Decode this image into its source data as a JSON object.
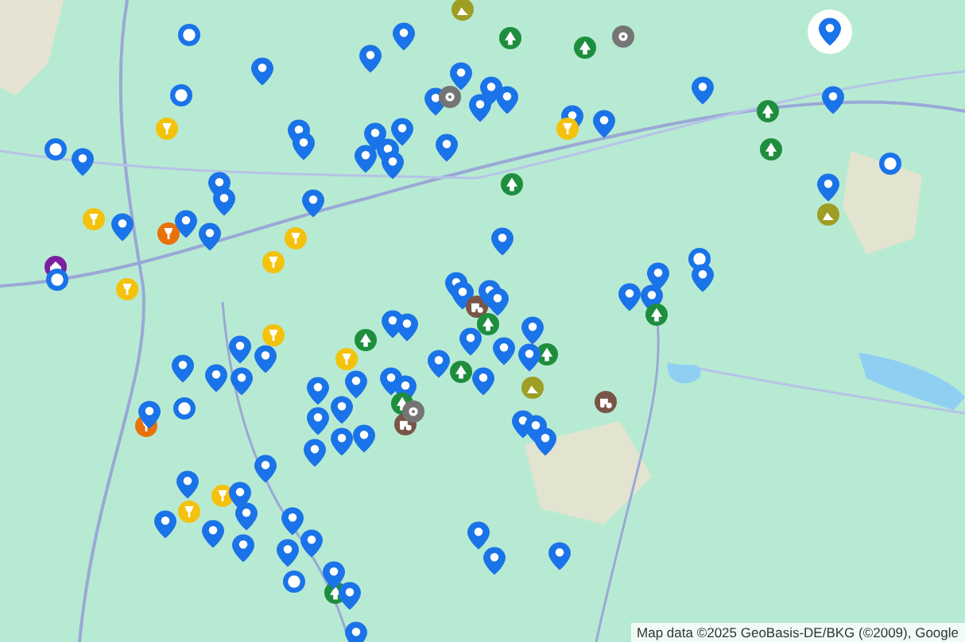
{
  "map": {
    "attribution": "Map data ©2025 GeoBasis-DE/BKG (©2009), Google"
  },
  "markers": [
    {
      "kind": "ring",
      "selected": false
    },
    {
      "kind": "ring",
      "selected": false
    },
    {
      "kind": "pin",
      "selected": false
    },
    {
      "kind": "cafe",
      "selected": false
    },
    {
      "kind": "ring",
      "selected": false
    },
    {
      "kind": "pin",
      "selected": false
    },
    {
      "kind": "pin",
      "selected": false
    },
    {
      "kind": "pin",
      "selected": false
    },
    {
      "kind": "pin",
      "selected": false
    },
    {
      "kind": "pin",
      "selected": false
    },
    {
      "kind": "pin",
      "selected": false
    },
    {
      "kind": "pin",
      "selected": false
    },
    {
      "kind": "pin",
      "selected": false
    },
    {
      "kind": "pin",
      "selected": false
    },
    {
      "kind": "pin",
      "selected": false
    },
    {
      "kind": "pin",
      "selected": false
    },
    {
      "kind": "pin",
      "selected": false
    },
    {
      "kind": "pin",
      "selected": false
    },
    {
      "kind": "pin",
      "selected": false
    },
    {
      "kind": "pin",
      "selected": false
    },
    {
      "kind": "trail",
      "selected": false
    },
    {
      "kind": "pin",
      "selected": false
    },
    {
      "kind": "camera",
      "selected": false
    },
    {
      "kind": "pin",
      "selected": false
    },
    {
      "kind": "cafe",
      "selected": false
    },
    {
      "kind": "cafe",
      "selected": false
    },
    {
      "kind": "cafe",
      "selected": false
    },
    {
      "kind": "shop",
      "selected": false
    },
    {
      "kind": "pin",
      "selected": false
    },
    {
      "kind": "pin",
      "selected": false
    },
    {
      "kind": "pin",
      "selected": false
    },
    {
      "kind": "cafe",
      "selected": false
    },
    {
      "kind": "venue",
      "selected": false
    },
    {
      "kind": "ring",
      "selected": false
    },
    {
      "kind": "pin",
      "selected": false
    },
    {
      "kind": "pin",
      "selected": false
    },
    {
      "kind": "farm",
      "selected": false
    },
    {
      "kind": "park",
      "selected": false
    },
    {
      "kind": "park",
      "selected": false
    },
    {
      "kind": "camera",
      "selected": false
    },
    {
      "kind": "pin",
      "selected": false
    },
    {
      "kind": "pin",
      "selected": false
    },
    {
      "kind": "pin",
      "selected": false
    },
    {
      "kind": "pin",
      "selected": false
    },
    {
      "kind": "cafe",
      "selected": false
    },
    {
      "kind": "pin",
      "selected": false
    },
    {
      "kind": "pin",
      "selected": true
    },
    {
      "kind": "park",
      "selected": false
    },
    {
      "kind": "park",
      "selected": false
    },
    {
      "kind": "pin",
      "selected": false
    },
    {
      "kind": "ring",
      "selected": false
    },
    {
      "kind": "pin",
      "selected": false
    },
    {
      "kind": "trail",
      "selected": false
    },
    {
      "kind": "park",
      "selected": false
    },
    {
      "kind": "pin",
      "selected": false
    },
    {
      "kind": "ring",
      "selected": false
    },
    {
      "kind": "pin",
      "selected": false
    },
    {
      "kind": "pin",
      "selected": false
    },
    {
      "kind": "pin",
      "selected": false
    },
    {
      "kind": "pin",
      "selected": false
    },
    {
      "kind": "pin",
      "selected": false
    },
    {
      "kind": "pin",
      "selected": false
    },
    {
      "kind": "park",
      "selected": false
    },
    {
      "kind": "cafe",
      "selected": false
    },
    {
      "kind": "park",
      "selected": false
    },
    {
      "kind": "pin",
      "selected": false
    },
    {
      "kind": "pin",
      "selected": false
    },
    {
      "kind": "park",
      "selected": false
    },
    {
      "kind": "pin",
      "selected": false
    },
    {
      "kind": "pin",
      "selected": false
    },
    {
      "kind": "cafe",
      "selected": false
    },
    {
      "kind": "pin",
      "selected": false
    },
    {
      "kind": "pin",
      "selected": false
    },
    {
      "kind": "pin",
      "selected": false
    },
    {
      "kind": "park",
      "selected": false
    },
    {
      "kind": "farm",
      "selected": false
    },
    {
      "kind": "camera",
      "selected": false
    },
    {
      "kind": "pin",
      "selected": false
    },
    {
      "kind": "pin",
      "selected": false
    },
    {
      "kind": "ring",
      "selected": false
    },
    {
      "kind": "shop",
      "selected": false
    },
    {
      "kind": "pin",
      "selected": false
    },
    {
      "kind": "pin",
      "selected": false
    },
    {
      "kind": "pin",
      "selected": false
    },
    {
      "kind": "pin",
      "selected": false
    },
    {
      "kind": "pin",
      "selected": false
    },
    {
      "kind": "pin",
      "selected": false
    },
    {
      "kind": "pin",
      "selected": false
    },
    {
      "kind": "pin",
      "selected": false
    },
    {
      "kind": "pin",
      "selected": false
    },
    {
      "kind": "pin",
      "selected": false
    },
    {
      "kind": "cafe",
      "selected": false
    },
    {
      "kind": "cafe",
      "selected": false
    },
    {
      "kind": "pin",
      "selected": false
    },
    {
      "kind": "pin",
      "selected": false
    },
    {
      "kind": "pin",
      "selected": false
    },
    {
      "kind": "pin",
      "selected": false
    },
    {
      "kind": "pin",
      "selected": false
    },
    {
      "kind": "pin",
      "selected": false
    },
    {
      "kind": "pin",
      "selected": false
    },
    {
      "kind": "pin",
      "selected": false
    },
    {
      "kind": "ring",
      "selected": false
    },
    {
      "kind": "pin",
      "selected": false
    },
    {
      "kind": "pin",
      "selected": false
    },
    {
      "kind": "park",
      "selected": false
    },
    {
      "kind": "pin",
      "selected": false
    },
    {
      "kind": "pin",
      "selected": false
    },
    {
      "kind": "pin",
      "selected": false
    },
    {
      "kind": "pin",
      "selected": false
    },
    {
      "kind": "park",
      "selected": false
    },
    {
      "kind": "pin",
      "selected": false
    },
    {
      "kind": "trail",
      "selected": false
    },
    {
      "kind": "farm",
      "selected": false
    },
    {
      "kind": "pin",
      "selected": false
    },
    {
      "kind": "pin",
      "selected": false
    },
    {
      "kind": "pin",
      "selected": false
    },
    {
      "kind": "pin",
      "selected": false
    },
    {
      "kind": "pin",
      "selected": false
    },
    {
      "kind": "pin",
      "selected": false
    },
    {
      "kind": "pin",
      "selected": false
    },
    {
      "kind": "park",
      "selected": false
    },
    {
      "kind": "pin",
      "selected": false
    }
  ]
}
